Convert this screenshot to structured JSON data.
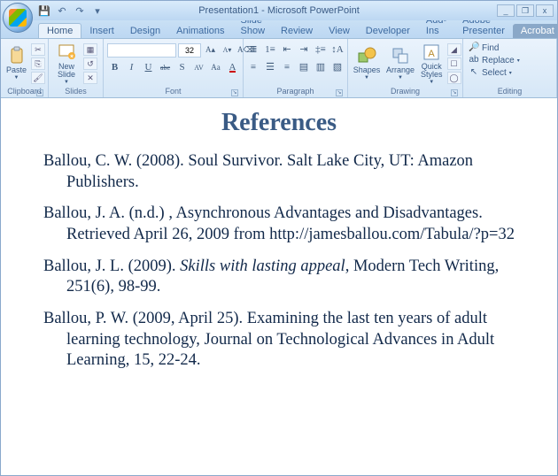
{
  "titlebar": {
    "app_title": "Presentation1 - Microsoft PowerPoint",
    "qat": {
      "save": "💾",
      "undo": "↶",
      "redo": "↷",
      "more": "▾"
    },
    "controls": {
      "minimize": "_",
      "maximize": "❐",
      "close": "x"
    }
  },
  "tabs": {
    "items": [
      {
        "label": "Home",
        "active": true
      },
      {
        "label": "Insert"
      },
      {
        "label": "Design"
      },
      {
        "label": "Animations"
      },
      {
        "label": "Slide Show"
      },
      {
        "label": "Review"
      },
      {
        "label": "View"
      },
      {
        "label": "Developer"
      },
      {
        "label": "Add-Ins"
      },
      {
        "label": "Adobe Presenter"
      },
      {
        "label": "Acrobat",
        "addon": true
      }
    ]
  },
  "ribbon": {
    "clipboard": {
      "label": "Clipboard",
      "paste": "Paste"
    },
    "slides": {
      "label": "Slides",
      "new_slide": "New\nSlide"
    },
    "font": {
      "label": "Font",
      "name_value": "",
      "size_value": "32",
      "bold": "B",
      "italic": "I",
      "underline": "U",
      "strike": "abc",
      "shadow": "S",
      "spacing": "AV",
      "changecase": "Aa",
      "grow": "A▴",
      "shrink": "A▾",
      "clear": "⌫"
    },
    "paragraph": {
      "label": "Paragraph"
    },
    "drawing": {
      "label": "Drawing",
      "shapes": "Shapes",
      "arrange": "Arrange",
      "quick_styles": "Quick\nStyles"
    },
    "editing": {
      "label": "Editing",
      "find": "Find",
      "replace": "Replace",
      "select": "Select"
    }
  },
  "slide": {
    "title": "References",
    "refs": [
      {
        "plain_a": "Ballou, C. W. (2008). Soul Survivor. Salt Lake City, UT: Amazon Publishers.",
        "ital": "",
        "plain_b": ""
      },
      {
        "plain_a": "Ballou, J. A. (n.d.) , Asynchronous Advantages and Disadvantages. Retrieved April 26, 2009 from http://jamesballou.com/Tabula/?p=32",
        "ital": "",
        "plain_b": ""
      },
      {
        "plain_a": "Ballou, J. L. (2009). ",
        "ital": "Skills with lasting appeal",
        "plain_b": ", Modern Tech Writing, 251(6), 98-99."
      },
      {
        "plain_a": "Ballou, P. W. (2009, April 25). Examining the last ten years of adult learning technology, Journal on Technological Advances in Adult Learning, 15, 22-24.",
        "ital": "",
        "plain_b": ""
      }
    ]
  }
}
